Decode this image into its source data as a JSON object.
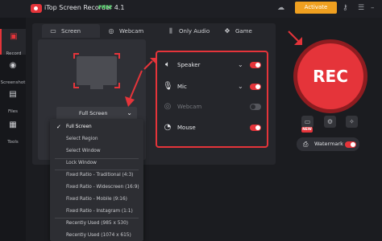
{
  "app": {
    "title": "iTop Screen Recorder 4.1",
    "edition": "FREE",
    "activate_label": "Activate"
  },
  "sidebar": {
    "items": [
      {
        "label": "Record",
        "icon": "record-icon"
      },
      {
        "label": "Screenshot",
        "icon": "camera-icon"
      },
      {
        "label": "Files",
        "icon": "files-icon"
      },
      {
        "label": "Tools",
        "icon": "tools-icon"
      }
    ]
  },
  "tabs": [
    {
      "label": "Screen",
      "icon": "monitor-icon",
      "active": true
    },
    {
      "label": "Webcam",
      "icon": "webcam-icon"
    },
    {
      "label": "Only Audio",
      "icon": "audio-bars-icon"
    },
    {
      "label": "Game",
      "icon": "gamepad-icon"
    }
  ],
  "capture": {
    "mode_value": "Full Screen",
    "options": [
      "Full Screen",
      "Select Region",
      "Select Window",
      "Lock Window",
      "Fixed Ratio - Traditional (4:3)",
      "Fixed Ratio - Widescreen (16:9)",
      "Fixed Ratio - Mobile (9:16)",
      "Fixed Ratio - Instagram (1:1)",
      "Recently Used (985 x 530)",
      "Recently Used (1074 x 615)"
    ]
  },
  "audio": [
    {
      "label": "Speaker",
      "icon": "speaker-icon",
      "on": true
    },
    {
      "label": "Mic",
      "icon": "mic-icon",
      "on": true
    },
    {
      "label": "Webcam",
      "icon": "webcam-icon",
      "on": false,
      "disabled": true
    },
    {
      "label": "Mouse",
      "icon": "mouse-icon",
      "on": true
    }
  ],
  "rec": {
    "label": "REC"
  },
  "badges": {
    "new": "NEW"
  },
  "watermark": {
    "label": "Watermark",
    "on": true
  },
  "colors": {
    "accent": "#e5343a",
    "activate": "#f0a020",
    "free": "#4cd964"
  }
}
